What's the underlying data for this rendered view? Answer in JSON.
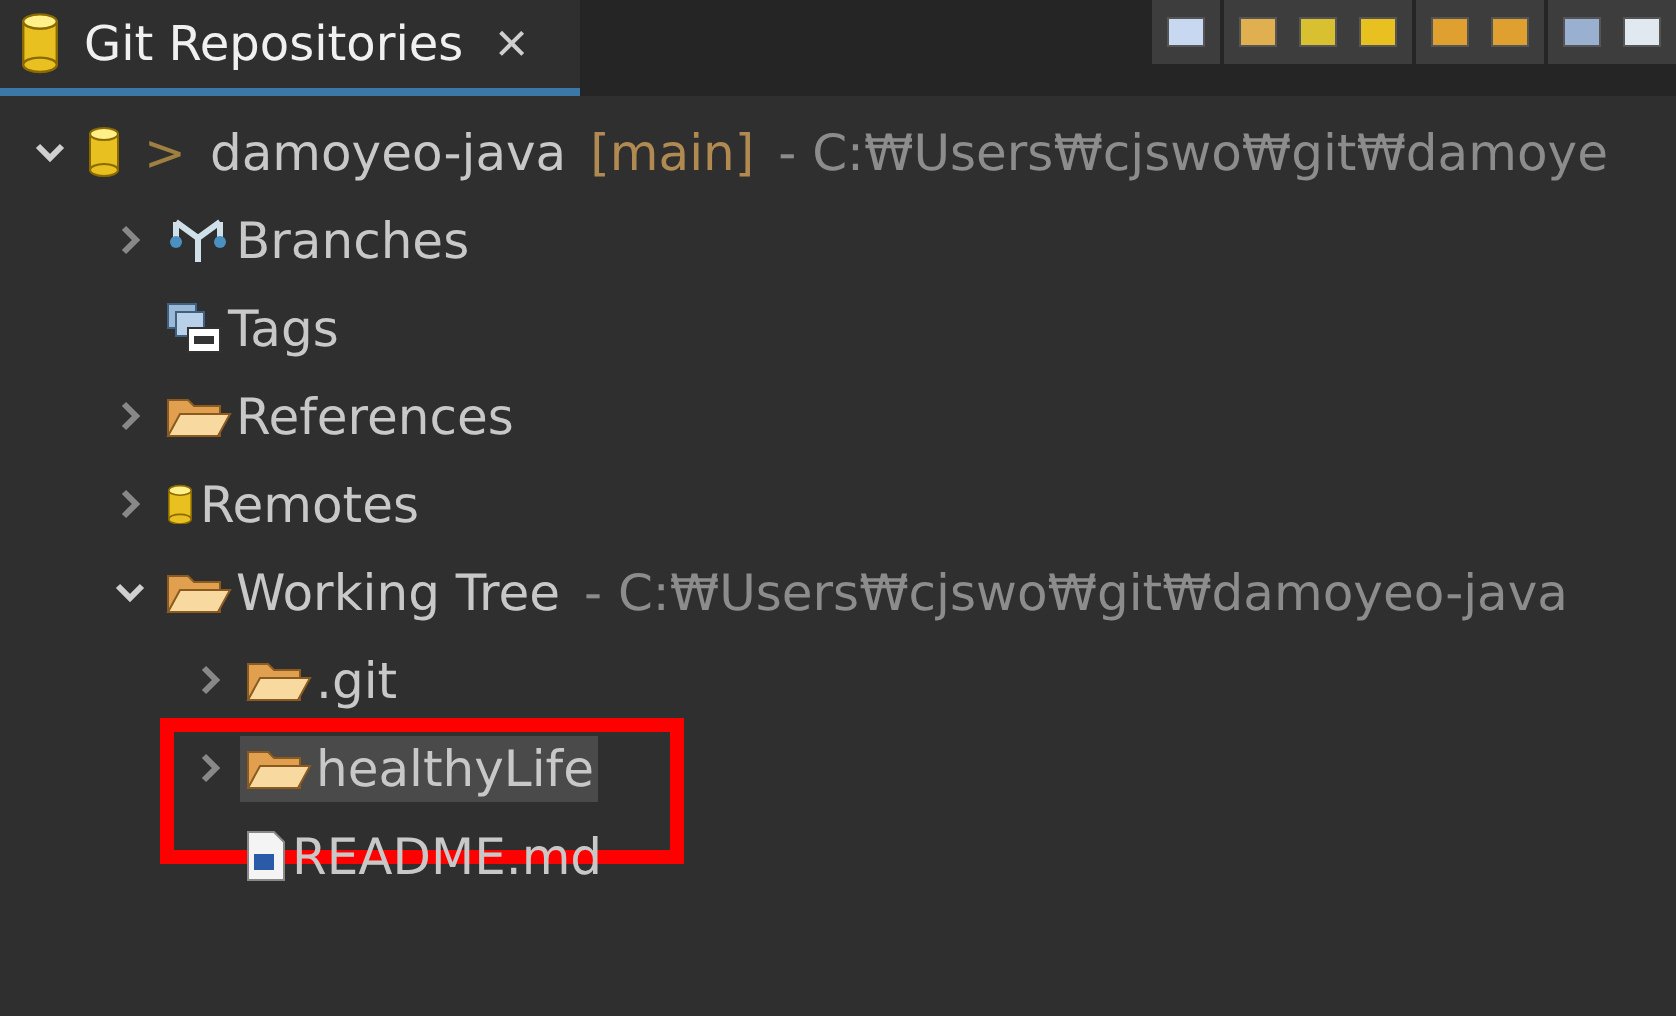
{
  "view_tab": {
    "title": "Git Repositories",
    "selected": true,
    "close": "×"
  },
  "tree": [
    {
      "kind": "repo",
      "prefix": ">",
      "label": "damoyeo-java",
      "branch": "[main]",
      "detail": "- C:₩Users₩cjswo₩git₩damoye",
      "expanded": true,
      "selected": false,
      "children": [
        {
          "kind": "branches",
          "label": "Branches",
          "expanded": false,
          "selected": false
        },
        {
          "kind": "tags",
          "label": "Tags",
          "selected": false
        },
        {
          "kind": "folder",
          "label": "References",
          "expanded": false,
          "selected": false
        },
        {
          "kind": "remote",
          "label": "Remotes",
          "expanded": false,
          "selected": false
        },
        {
          "kind": "folder",
          "label": "Working Tree",
          "detail": "- C:₩Users₩cjswo₩git₩damoyeo-java",
          "expanded": true,
          "selected": false,
          "children": [
            {
              "kind": "folder",
              "label": ".git",
              "expanded": false,
              "selected": false
            },
            {
              "kind": "folder",
              "label": "healthyLife",
              "expanded": false,
              "selected": true,
              "annotated": true
            },
            {
              "kind": "file",
              "label": "README.md",
              "selected": false
            }
          ]
        }
      ]
    }
  ]
}
